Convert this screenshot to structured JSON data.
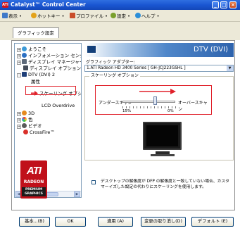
{
  "window": {
    "title": "Catalyst™ Control Center",
    "logo_text": "ATI"
  },
  "menubar": {
    "items": [
      {
        "label": "表示 •",
        "icon": "view-icon"
      },
      {
        "label": "ホットキー •",
        "icon": "hotkey-icon"
      },
      {
        "label": "プロファイル •",
        "icon": "profile-icon"
      },
      {
        "label": "設定 •",
        "icon": "settings-icon"
      },
      {
        "label": "ヘルプ •",
        "icon": "help-icon"
      }
    ]
  },
  "tab": {
    "label": "グラフィック設定"
  },
  "tree": {
    "items": [
      {
        "label": "ようこそ",
        "expander": "+"
      },
      {
        "label": "インフォメーション センタ",
        "expander": "+"
      },
      {
        "label": "ディスプレイ マネージャー",
        "expander": "+"
      },
      {
        "label": "ディスプレイ オプション",
        "expander": ""
      },
      {
        "label": "DTV (DVI) 2",
        "expander": "-"
      },
      {
        "label": "属性",
        "expander": ""
      },
      {
        "label": "スケーリング オプショ",
        "expander": ""
      },
      {
        "label": "LCD Overdrive",
        "expander": ""
      },
      {
        "label": "3D",
        "expander": "+"
      },
      {
        "label": "色",
        "expander": "+"
      },
      {
        "label": "ビデオ",
        "expander": "+"
      },
      {
        "label": "CrossFire™",
        "expander": ""
      }
    ],
    "selected": "スケーリング オプショ"
  },
  "logo": {
    "brand": "ATI",
    "line2": "RADEON",
    "line3": "PREMIUM",
    "line4": "GRAPHICS"
  },
  "panel": {
    "banner_title": "DTV (DVI)",
    "adapter_label": "グラフィック アダプター:",
    "adapter_value": "1.ATI Radeon HD 3400 Series [ GH-JCJ223GSHL ]",
    "group_title": "スケーリング オプション",
    "under_label": "アンダースキャン",
    "over_label": "オーバースキャン",
    "min_pct": "15%",
    "max_pct": "0%",
    "slider_value_fraction": 0.62,
    "checkbox_text": "デスクトップの解像度が DFP の解像度と一致していない場合、カスタマーイズした設定の代わりにスケーリングを使用します。",
    "checkbox_checked": false
  },
  "buttons": {
    "basic": "基本...(B)",
    "ok": "OK",
    "apply": "適用 (A)",
    "discard": "変更の取り消し(D)",
    "defaults": "デフォルト (E)"
  },
  "colors": {
    "highlight": "#e0202a",
    "ati_red": "#c0101a",
    "title_blue": "#1a56d2"
  }
}
